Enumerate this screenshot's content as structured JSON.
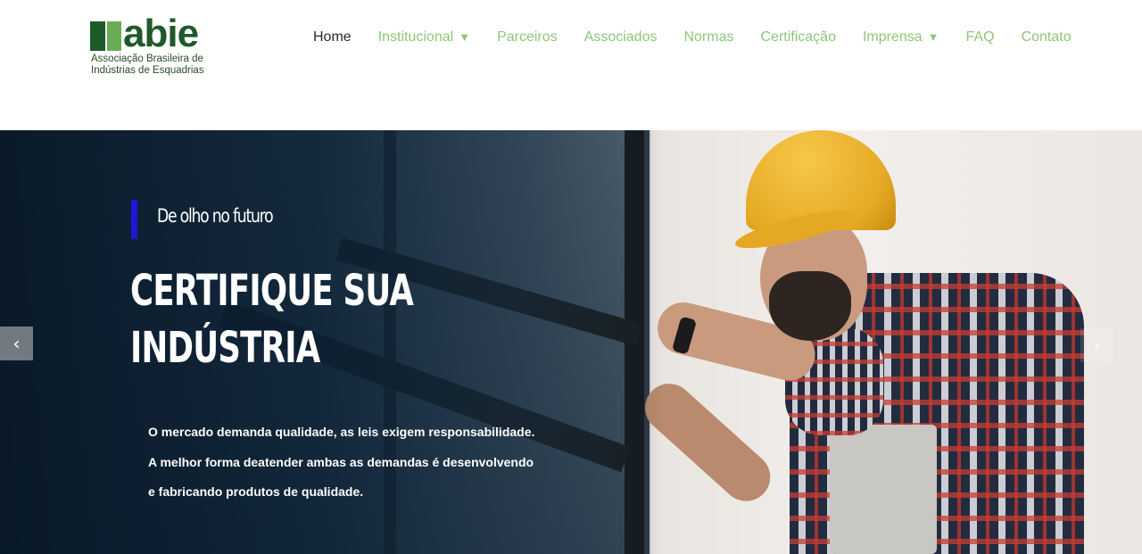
{
  "brand": {
    "logo_word": "abie",
    "subtitle_line1": "Associação Brasileira de",
    "subtitle_line2": "Indústrias de Esquadrias",
    "mark_colors": [
      "#1e5a2a",
      "#6aab55"
    ]
  },
  "nav": {
    "items": [
      {
        "label": "Home",
        "active": true,
        "dropdown": false
      },
      {
        "label": "Institucional",
        "active": false,
        "dropdown": true
      },
      {
        "label": "Parceiros",
        "active": false,
        "dropdown": false
      },
      {
        "label": "Associados",
        "active": false,
        "dropdown": false
      },
      {
        "label": "Normas",
        "active": false,
        "dropdown": false
      },
      {
        "label": "Certificação",
        "active": false,
        "dropdown": false
      },
      {
        "label": "Imprensa",
        "active": false,
        "dropdown": true
      },
      {
        "label": "FAQ",
        "active": false,
        "dropdown": false
      },
      {
        "label": "Contato",
        "active": false,
        "dropdown": false
      }
    ],
    "dropdown_glyph": "▼",
    "active_color": "#2a2a2a",
    "link_color": "#8fc67a"
  },
  "hero": {
    "eyebrow": "De olho no futuro",
    "eyebrow_bar_color": "#1d18d9",
    "headline_line1": "CERTIFIQUE SUA",
    "headline_line2": "INDÚSTRIA",
    "desc_line1": "O mercado demanda qualidade, as leis exigem responsabilidade.",
    "desc_line2": "A melhor forma deatender ambas as demandas é desenvolvendo",
    "desc_line3": "e fabricando produtos de qualidade.",
    "prev_icon": "‹",
    "next_icon": "›"
  }
}
